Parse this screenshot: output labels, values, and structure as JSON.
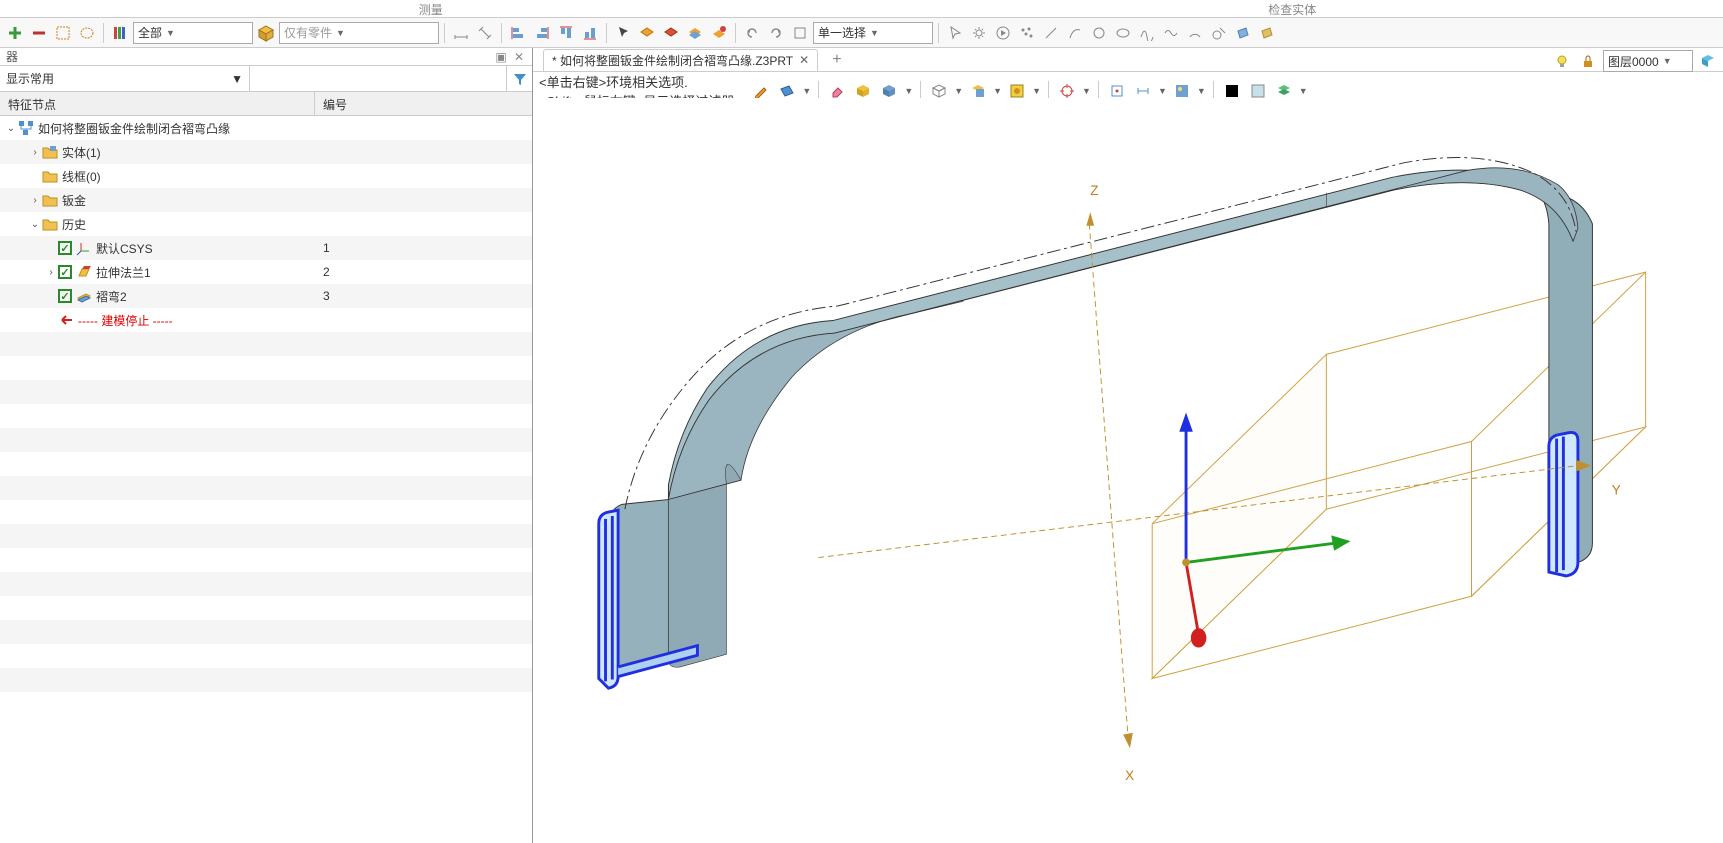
{
  "top_tabs": {
    "left": "测量",
    "right": "检查实体"
  },
  "toolbar": {
    "all_label": "全部",
    "only_part_label": "仅有零件",
    "single_select_label": "单一选择"
  },
  "panel": {
    "title": "器",
    "filter_label": "显示常用",
    "col_feature": "特征节点",
    "col_number": "编号"
  },
  "tree": {
    "root": "如何将整圈钣金件绘制闭合褶弯凸缘",
    "entity": "实体(1)",
    "wireframe": "线框(0)",
    "sheetmetal": "钣金",
    "history": "历史",
    "csys": "默认CSYS",
    "csys_num": "1",
    "flange": "拉伸法兰1",
    "flange_num": "2",
    "hem": "褶弯2",
    "hem_num": "3",
    "stop": "----- 建模停止 -----"
  },
  "doc": {
    "tab_name": "* 如何将整圈钣金件绘制闭合褶弯凸缘.Z3PRT",
    "hint_line1": "<单击右键>环境相关选项.",
    "hint_line2": "<Shift +鼠标右键>显示选择过滤器"
  },
  "layer": {
    "label": "图层0000"
  },
  "axes": {
    "x": "X",
    "y": "Y",
    "z": "Z"
  }
}
